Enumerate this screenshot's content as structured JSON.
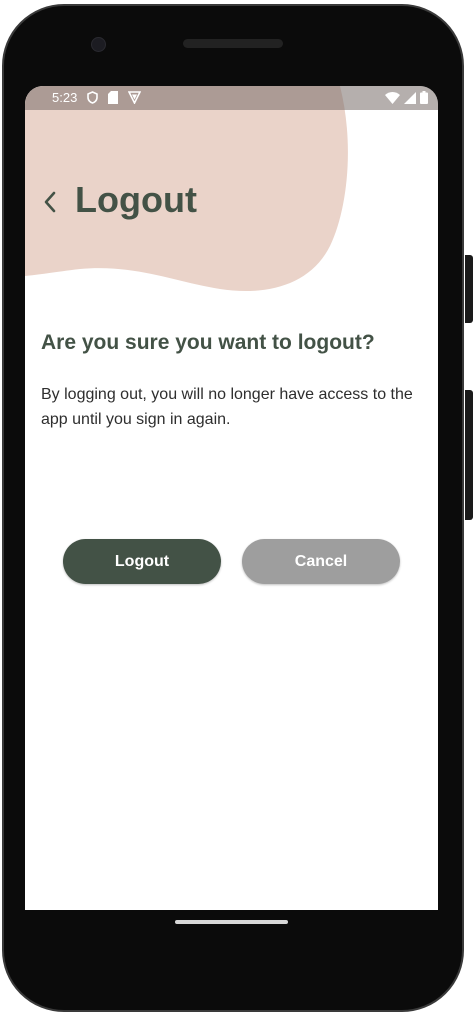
{
  "status_bar": {
    "time": "5:23",
    "left_icons": [
      "shield-icon",
      "sim-card-icon",
      "vpn-shield-icon"
    ],
    "right_icons": [
      "wifi-icon",
      "cellular-signal-icon",
      "battery-icon"
    ]
  },
  "header": {
    "back_icon": "chevron-left-icon",
    "title": "Logout"
  },
  "content": {
    "question": "Are you sure you want to logout?",
    "description": "By logging out, you will no longer have access to the app until you sign in again."
  },
  "actions": {
    "logout_label": "Logout",
    "cancel_label": "Cancel"
  },
  "colors": {
    "accent": "#435246",
    "blob": "#ead3c9",
    "cancel": "#9e9e9e"
  }
}
